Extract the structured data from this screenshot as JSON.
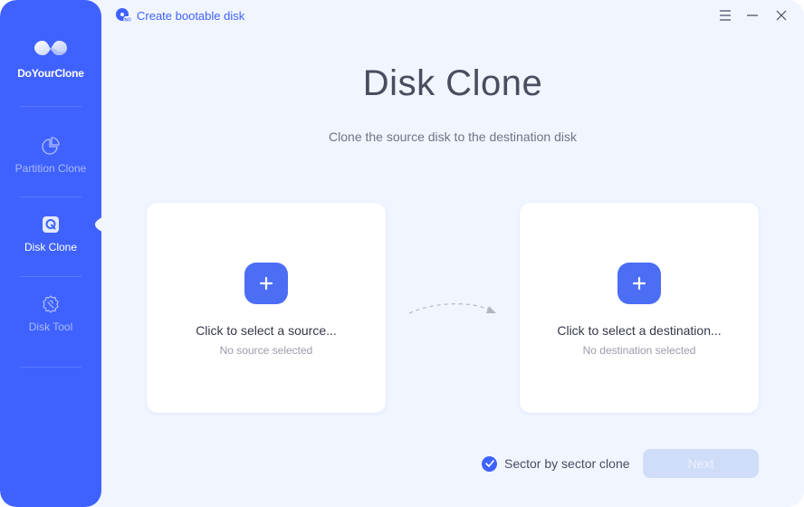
{
  "app": {
    "name": "DoYourClone",
    "logo_icon": "infinity-cloud-logo"
  },
  "sidebar": {
    "items": [
      {
        "id": "partition-clone",
        "label": "Partition Clone",
        "icon": "pie-chart-icon",
        "active": false
      },
      {
        "id": "disk-clone",
        "label": "Disk Clone",
        "icon": "disk-clone-icon",
        "active": true
      },
      {
        "id": "disk-tool",
        "label": "Disk Tool",
        "icon": "gear-wrench-icon",
        "active": false
      }
    ]
  },
  "titlebar": {
    "link_label": "Create bootable disk",
    "link_icon": "iso-disc-icon",
    "buttons": [
      "menu-icon",
      "minimize-icon",
      "close-icon"
    ]
  },
  "main": {
    "title": "Disk Clone",
    "subtitle": "Clone the source disk to the destination disk",
    "source_card": {
      "title": "Click to select a source...",
      "status": "No source selected"
    },
    "destination_card": {
      "title": "Click to select a destination...",
      "status": "No destination selected"
    }
  },
  "footer": {
    "sector_clone_label": "Sector by sector clone",
    "sector_clone_checked": true,
    "next_label": "Next",
    "next_enabled": false
  },
  "colors": {
    "accent": "#3f62ff",
    "background": "#f1f5ff",
    "card": "#ffffff",
    "next_disabled": "#d0ddf9"
  }
}
